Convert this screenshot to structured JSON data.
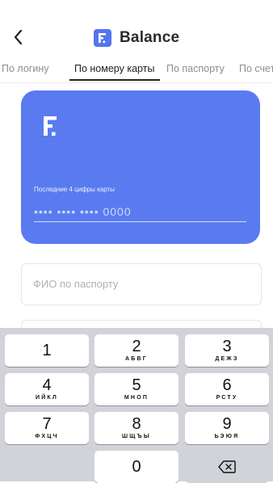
{
  "header": {
    "title": "Balance",
    "logo_letter": "F",
    "back_icon": "chevron-left-icon"
  },
  "tabs": [
    {
      "label": "По логину",
      "active": false
    },
    {
      "label": "По номеру карты",
      "active": true
    },
    {
      "label": "По паспорту",
      "active": false
    },
    {
      "label": "По счет",
      "active": false
    }
  ],
  "card": {
    "color": "#5a7bf0",
    "logo_letter": "F",
    "label": "Последние 4 цифры карты",
    "mask": "•••• •••• •••• 0000"
  },
  "form": {
    "fio_placeholder": "ФИО по паспорту"
  },
  "keyboard": {
    "keys": [
      {
        "num": "1",
        "letters": ""
      },
      {
        "num": "2",
        "letters": "АБВГ"
      },
      {
        "num": "3",
        "letters": "ДЕЖЗ"
      },
      {
        "num": "4",
        "letters": "ИЙКЛ"
      },
      {
        "num": "5",
        "letters": "МНОП"
      },
      {
        "num": "6",
        "letters": "РСТУ"
      },
      {
        "num": "7",
        "letters": "ФХЦЧ"
      },
      {
        "num": "8",
        "letters": "ШЩЪЫ"
      },
      {
        "num": "9",
        "letters": "ЬЭЮЯ"
      },
      {
        "num": "0",
        "letters": ""
      }
    ],
    "delete_icon": "backspace-icon"
  }
}
